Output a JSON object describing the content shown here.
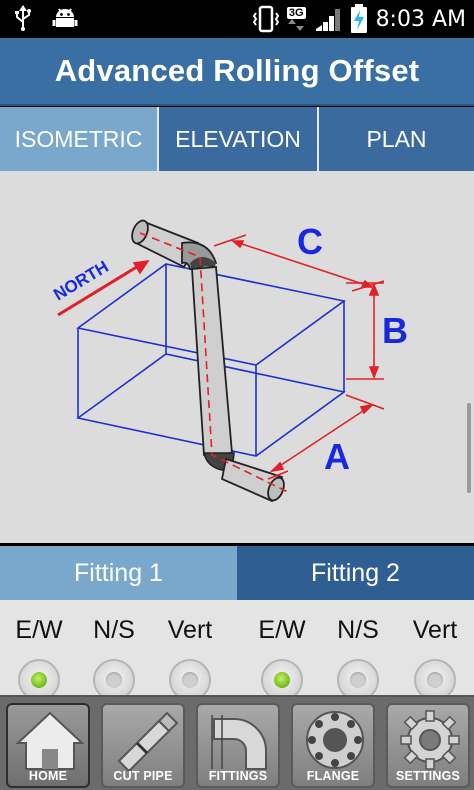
{
  "status_bar": {
    "time": "8:03 AM",
    "network": "3G"
  },
  "app": {
    "title": "Advanced Rolling Offset"
  },
  "tabs": [
    {
      "label": "ISOMETRIC",
      "active": true
    },
    {
      "label": "ELEVATION",
      "active": false
    },
    {
      "label": "PLAN",
      "active": false
    }
  ],
  "diagram": {
    "north_label": "NORTH",
    "label_a": "A",
    "label_b": "B",
    "label_c": "C"
  },
  "fittings": {
    "fitting1": "Fitting 1",
    "fitting2": "Fitting 2"
  },
  "directions": {
    "f1_ew": "E/W",
    "f1_ns": "N/S",
    "f1_vert": "Vert",
    "f2_ew": "E/W",
    "f2_ns": "N/S",
    "f2_vert": "Vert"
  },
  "selected": {
    "fitting1": "E/W",
    "fitting2": "E/W"
  },
  "nav": {
    "home": "HOME",
    "cut_pipe": "CUT PIPE",
    "fittings": "FITTINGS",
    "flange": "FLANGE",
    "settings": "SETTINGS"
  },
  "colors": {
    "accent": "#3a6fa3",
    "tab_active": "#7aa7cc",
    "box_lines": "#1f2fd0",
    "dimension_lines": "#e0202a",
    "label_blue": "#1828e0"
  }
}
